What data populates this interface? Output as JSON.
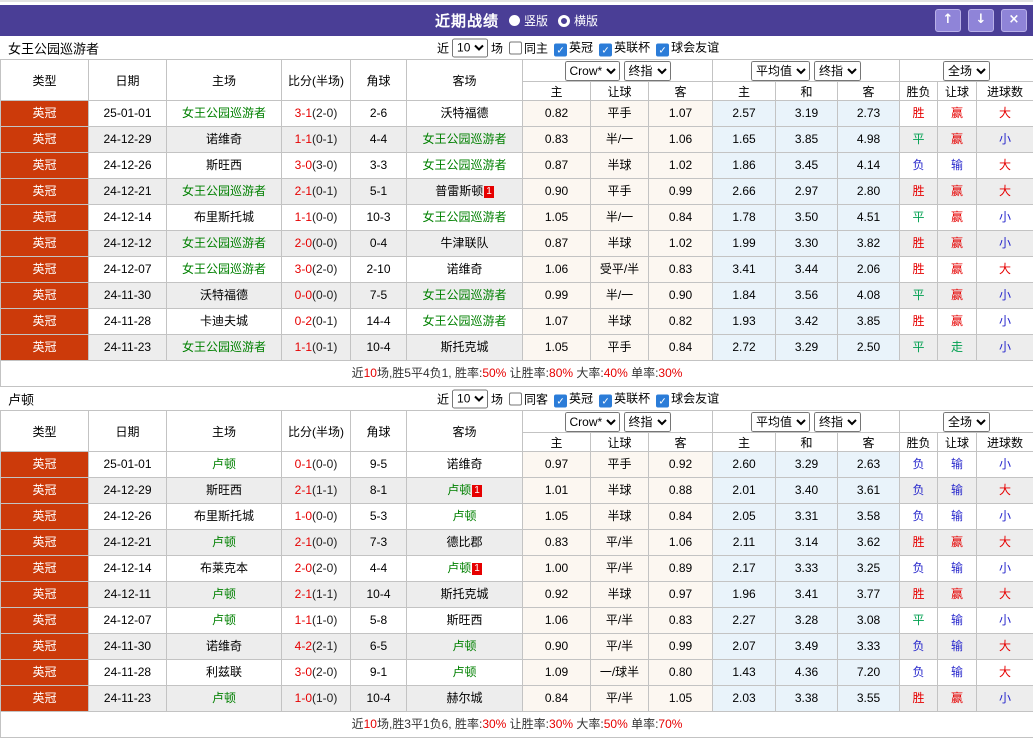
{
  "titlebar": {
    "title": "近期战绩",
    "view_options": [
      {
        "label": "竖版",
        "selected": true
      },
      {
        "label": "横版",
        "selected": false
      }
    ],
    "buttons": {
      "up": "↑",
      "down": "↓",
      "close": "×"
    }
  },
  "controls": {
    "near": "近",
    "games_value": "10",
    "matches": "场",
    "leagues": [
      "英冠",
      "英联杯",
      "球会友谊"
    ],
    "bookmaker": "Crow*",
    "bookmaker_stage": "终指",
    "average": "平均值",
    "average_stage": "终指",
    "scope": "全场"
  },
  "table_header": {
    "type": "类型",
    "date": "日期",
    "home": "主场",
    "score": "比分(半场)",
    "corner": "角球",
    "away": "客场",
    "sub": {
      "crow_home": "主",
      "crow_handicap": "让球",
      "crow_away": "客",
      "avg_home": "主",
      "avg_draw": "和",
      "avg_away": "客",
      "wdl": "胜负",
      "handicap": "让球",
      "goals": "进球数"
    }
  },
  "colors": {
    "accent_purple": "#4a3e96",
    "league_badge": "#cc3a0a",
    "win_red": "#e60000",
    "draw_green": "#00a050",
    "loss_blue": "#2828cc",
    "focus_team_green": "#008000"
  },
  "sections": [
    {
      "team": "女王公园巡游者",
      "same_filter": "同主",
      "rows": [
        {
          "league": "英冠",
          "date": "25-01-01",
          "home": "女王公园巡游者",
          "home_focus": true,
          "score": "3-1",
          "half": "(2-0)",
          "corner": "2-6",
          "away": "沃特福德",
          "o_home": "0.82",
          "o_hcap": "平手",
          "o_away": "1.07",
          "a_home": "2.57",
          "a_draw": "3.19",
          "a_away": "2.73",
          "wdl": "胜",
          "hres": "赢",
          "goals": "大"
        },
        {
          "league": "英冠",
          "date": "24-12-29",
          "home": "诺维奇",
          "score": "1-1",
          "half": "(0-1)",
          "corner": "4-4",
          "away": "女王公园巡游者",
          "away_focus": true,
          "o_home": "0.83",
          "o_hcap": "半/一",
          "o_away": "1.06",
          "a_home": "1.65",
          "a_draw": "3.85",
          "a_away": "4.98",
          "wdl": "平",
          "hres": "赢",
          "goals": "小"
        },
        {
          "league": "英冠",
          "date": "24-12-26",
          "home": "斯旺西",
          "score": "3-0",
          "half": "(3-0)",
          "corner": "3-3",
          "away": "女王公园巡游者",
          "away_focus": true,
          "o_home": "0.87",
          "o_hcap": "半球",
          "o_away": "1.02",
          "a_home": "1.86",
          "a_draw": "3.45",
          "a_away": "4.14",
          "wdl": "负",
          "hres": "输",
          "goals": "大"
        },
        {
          "league": "英冠",
          "date": "24-12-21",
          "home": "女王公园巡游者",
          "home_focus": true,
          "score": "2-1",
          "half": "(0-1)",
          "corner": "5-1",
          "away": "普雷斯顿",
          "away_rc": "1",
          "o_home": "0.90",
          "o_hcap": "平手",
          "o_away": "0.99",
          "a_home": "2.66",
          "a_draw": "2.97",
          "a_away": "2.80",
          "wdl": "胜",
          "hres": "赢",
          "goals": "大"
        },
        {
          "league": "英冠",
          "date": "24-12-14",
          "home": "布里斯托城",
          "score": "1-1",
          "half": "(0-0)",
          "corner": "10-3",
          "away": "女王公园巡游者",
          "away_focus": true,
          "o_home": "1.05",
          "o_hcap": "半/一",
          "o_away": "0.84",
          "a_home": "1.78",
          "a_draw": "3.50",
          "a_away": "4.51",
          "wdl": "平",
          "hres": "赢",
          "goals": "小"
        },
        {
          "league": "英冠",
          "date": "24-12-12",
          "home": "女王公园巡游者",
          "home_focus": true,
          "score": "2-0",
          "half": "(0-0)",
          "corner": "0-4",
          "away": "牛津联队",
          "o_home": "0.87",
          "o_hcap": "半球",
          "o_away": "1.02",
          "a_home": "1.99",
          "a_draw": "3.30",
          "a_away": "3.82",
          "wdl": "胜",
          "hres": "赢",
          "goals": "小"
        },
        {
          "league": "英冠",
          "date": "24-12-07",
          "home": "女王公园巡游者",
          "home_focus": true,
          "score": "3-0",
          "half": "(2-0)",
          "corner": "2-10",
          "away": "诺维奇",
          "o_home": "1.06",
          "o_hcap": "受平/半",
          "o_away": "0.83",
          "a_home": "3.41",
          "a_draw": "3.44",
          "a_away": "2.06",
          "wdl": "胜",
          "hres": "赢",
          "goals": "大"
        },
        {
          "league": "英冠",
          "date": "24-11-30",
          "home": "沃特福德",
          "score": "0-0",
          "half": "(0-0)",
          "corner": "7-5",
          "away": "女王公园巡游者",
          "away_focus": true,
          "o_home": "0.99",
          "o_hcap": "半/一",
          "o_away": "0.90",
          "a_home": "1.84",
          "a_draw": "3.56",
          "a_away": "4.08",
          "wdl": "平",
          "hres": "赢",
          "goals": "小"
        },
        {
          "league": "英冠",
          "date": "24-11-28",
          "home": "卡迪夫城",
          "score": "0-2",
          "half": "(0-1)",
          "corner": "14-4",
          "away": "女王公园巡游者",
          "away_focus": true,
          "o_home": "1.07",
          "o_hcap": "半球",
          "o_away": "0.82",
          "a_home": "1.93",
          "a_draw": "3.42",
          "a_away": "3.85",
          "wdl": "胜",
          "hres": "赢",
          "goals": "小"
        },
        {
          "league": "英冠",
          "date": "24-11-23",
          "home": "女王公园巡游者",
          "home_focus": true,
          "score": "1-1",
          "half": "(0-1)",
          "corner": "10-4",
          "away": "斯托克城",
          "o_home": "1.05",
          "o_hcap": "平手",
          "o_away": "0.84",
          "a_home": "2.72",
          "a_draw": "3.29",
          "a_away": "2.50",
          "wdl": "平",
          "hres": "走",
          "goals": "小"
        }
      ],
      "summary": [
        {
          "t": "近"
        },
        {
          "t": "10",
          "r": true
        },
        {
          "t": "场,胜5平4负1, 胜率:"
        },
        {
          "t": "50%",
          "r": true
        },
        {
          "t": " 让胜率:"
        },
        {
          "t": "80%",
          "r": true
        },
        {
          "t": " 大率:"
        },
        {
          "t": "40%",
          "r": true
        },
        {
          "t": " 单率:"
        },
        {
          "t": "30%",
          "r": true
        }
      ]
    },
    {
      "team": "卢顿",
      "same_filter": "同客",
      "rows": [
        {
          "league": "英冠",
          "date": "25-01-01",
          "home": "卢顿",
          "home_focus": true,
          "score": "0-1",
          "half": "(0-0)",
          "corner": "9-5",
          "away": "诺维奇",
          "o_home": "0.97",
          "o_hcap": "平手",
          "o_away": "0.92",
          "a_home": "2.60",
          "a_draw": "3.29",
          "a_away": "2.63",
          "wdl": "负",
          "hres": "输",
          "goals": "小"
        },
        {
          "league": "英冠",
          "date": "24-12-29",
          "home": "斯旺西",
          "score": "2-1",
          "half": "(1-1)",
          "corner": "8-1",
          "away": "卢顿",
          "away_focus": true,
          "away_rc": "1",
          "o_home": "1.01",
          "o_hcap": "半球",
          "o_away": "0.88",
          "a_home": "2.01",
          "a_draw": "3.40",
          "a_away": "3.61",
          "wdl": "负",
          "hres": "输",
          "goals": "大"
        },
        {
          "league": "英冠",
          "date": "24-12-26",
          "home": "布里斯托城",
          "score": "1-0",
          "half": "(0-0)",
          "corner": "5-3",
          "away": "卢顿",
          "away_focus": true,
          "o_home": "1.05",
          "o_hcap": "半球",
          "o_away": "0.84",
          "a_home": "2.05",
          "a_draw": "3.31",
          "a_away": "3.58",
          "wdl": "负",
          "hres": "输",
          "goals": "小"
        },
        {
          "league": "英冠",
          "date": "24-12-21",
          "home": "卢顿",
          "home_focus": true,
          "score": "2-1",
          "half": "(0-0)",
          "corner": "7-3",
          "away": "德比郡",
          "o_home": "0.83",
          "o_hcap": "平/半",
          "o_away": "1.06",
          "a_home": "2.11",
          "a_draw": "3.14",
          "a_away": "3.62",
          "wdl": "胜",
          "hres": "赢",
          "goals": "大"
        },
        {
          "league": "英冠",
          "date": "24-12-14",
          "home": "布莱克本",
          "score": "2-0",
          "half": "(2-0)",
          "corner": "4-4",
          "away": "卢顿",
          "away_focus": true,
          "away_rc": "1",
          "o_home": "1.00",
          "o_hcap": "平/半",
          "o_away": "0.89",
          "a_home": "2.17",
          "a_draw": "3.33",
          "a_away": "3.25",
          "wdl": "负",
          "hres": "输",
          "goals": "小"
        },
        {
          "league": "英冠",
          "date": "24-12-11",
          "home": "卢顿",
          "home_focus": true,
          "score": "2-1",
          "half": "(1-1)",
          "corner": "10-4",
          "away": "斯托克城",
          "o_home": "0.92",
          "o_hcap": "半球",
          "o_away": "0.97",
          "a_home": "1.96",
          "a_draw": "3.41",
          "a_away": "3.77",
          "wdl": "胜",
          "hres": "赢",
          "goals": "大"
        },
        {
          "league": "英冠",
          "date": "24-12-07",
          "home": "卢顿",
          "home_focus": true,
          "score": "1-1",
          "half": "(1-0)",
          "corner": "5-8",
          "away": "斯旺西",
          "o_home": "1.06",
          "o_hcap": "平/半",
          "o_away": "0.83",
          "a_home": "2.27",
          "a_draw": "3.28",
          "a_away": "3.08",
          "wdl": "平",
          "hres": "输",
          "goals": "小"
        },
        {
          "league": "英冠",
          "date": "24-11-30",
          "home": "诺维奇",
          "score": "4-2",
          "half": "(2-1)",
          "corner": "6-5",
          "away": "卢顿",
          "away_focus": true,
          "o_home": "0.90",
          "o_hcap": "平/半",
          "o_away": "0.99",
          "a_home": "2.07",
          "a_draw": "3.49",
          "a_away": "3.33",
          "wdl": "负",
          "hres": "输",
          "goals": "大"
        },
        {
          "league": "英冠",
          "date": "24-11-28",
          "home": "利兹联",
          "score": "3-0",
          "half": "(2-0)",
          "corner": "9-1",
          "away": "卢顿",
          "away_focus": true,
          "o_home": "1.09",
          "o_hcap": "一/球半",
          "o_away": "0.80",
          "a_home": "1.43",
          "a_draw": "4.36",
          "a_away": "7.20",
          "wdl": "负",
          "hres": "输",
          "goals": "大"
        },
        {
          "league": "英冠",
          "date": "24-11-23",
          "home": "卢顿",
          "home_focus": true,
          "score": "1-0",
          "half": "(1-0)",
          "corner": "10-4",
          "away": "赫尔城",
          "o_home": "0.84",
          "o_hcap": "平/半",
          "o_away": "1.05",
          "a_home": "2.03",
          "a_draw": "3.38",
          "a_away": "3.55",
          "wdl": "胜",
          "hres": "赢",
          "goals": "小"
        }
      ],
      "summary": [
        {
          "t": "近"
        },
        {
          "t": "10",
          "r": true
        },
        {
          "t": "场,胜3平1负6, 胜率:"
        },
        {
          "t": "30%",
          "r": true
        },
        {
          "t": " 让胜率:"
        },
        {
          "t": "30%",
          "r": true
        },
        {
          "t": " 大率:"
        },
        {
          "t": "50%",
          "r": true
        },
        {
          "t": " 单率:"
        },
        {
          "t": "70%",
          "r": true
        }
      ]
    }
  ]
}
